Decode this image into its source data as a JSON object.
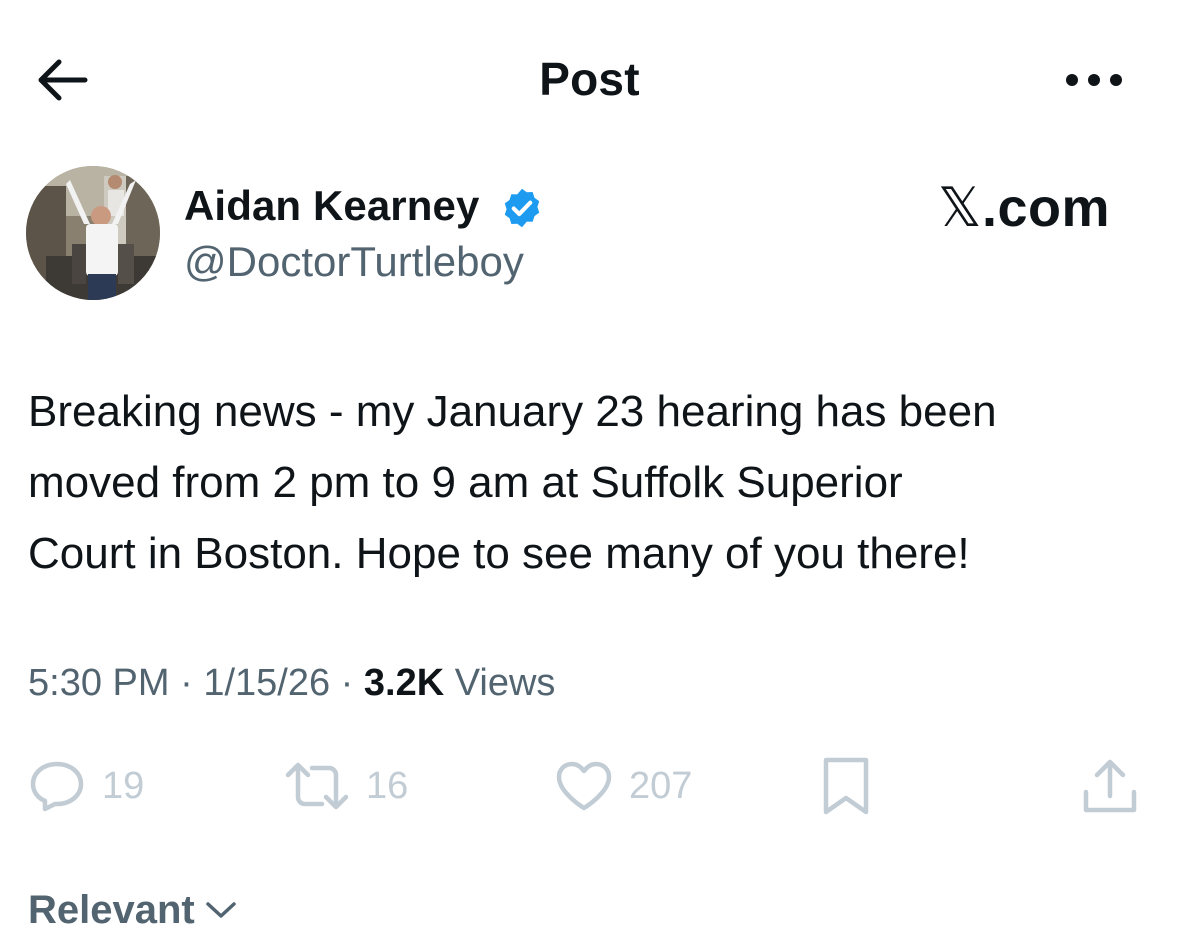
{
  "header": {
    "title": "Post",
    "back_icon": "arrow-left-icon",
    "more_icon": "more-horizontal-icon"
  },
  "author": {
    "display_name": "Aidan Kearney",
    "handle": "@DoctorTurtleboy",
    "verified": true,
    "badge_color": "#1d9bf0"
  },
  "watermark": {
    "mark": "𝕏",
    "text": ".com"
  },
  "post": {
    "lines": [
      "Breaking news - my January 23 hearing has been",
      "moved from 2 pm to 9 am at Suffolk Superior",
      "Court in Boston. Hope to see many of you there!"
    ],
    "time": "5:30 PM",
    "separator": "·",
    "date": "1/15/26",
    "views_count": "3.2K",
    "views_label": "Views"
  },
  "actions": {
    "replies": "19",
    "reposts": "16",
    "likes": "207",
    "icon_color": "#c2ccd4"
  },
  "sort": {
    "label": "Relevant"
  },
  "colors": {
    "text": "#0f1419",
    "secondary": "#536471",
    "background": "#ffffff"
  }
}
